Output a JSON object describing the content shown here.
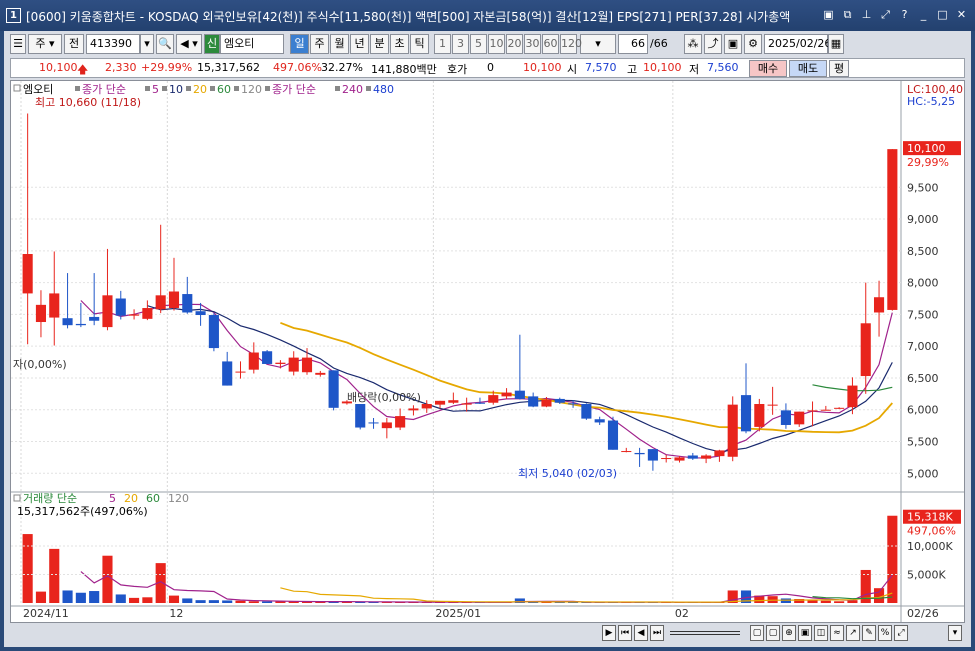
{
  "window": {
    "num": "1",
    "title": "[0600] 키움종합차트 - KOSDAQ 외국인보유[42(천)] 주식수[11,580(천)] 액면[500] 자본금[58(억)] 결산[12월] EPS[271] PER[37.28] 시가총액",
    "icons": [
      "restore-icon",
      "copy-icon",
      "pin-icon",
      "expand-icon",
      "help-icon",
      "minimize-icon",
      "maximize-icon",
      "close-icon"
    ]
  },
  "toolbar": {
    "market": "주",
    "prev": "전",
    "code": "413390",
    "badge": "신",
    "name": "엠오티",
    "periods": [
      "일",
      "주",
      "월",
      "년",
      "분",
      "초",
      "틱"
    ],
    "intervals": [
      "1",
      "3",
      "5",
      "10",
      "20",
      "30",
      "60",
      "120"
    ],
    "count": "66",
    "count_total": "/66",
    "date": "2025/02/26"
  },
  "quote": {
    "price": "10,100",
    "change": "2,330",
    "change_pct": "+29.99%",
    "volume": "15,317,562",
    "volume_pct": "497.06%",
    "turnover": "32.27%",
    "amount": "141,880백만",
    "hoga_label": "호가",
    "hoga": "0",
    "hoga_price": "10,100",
    "open_label": "시",
    "open": "7,570",
    "high_label": "고",
    "high": "10,100",
    "low_label": "저",
    "low": "7,560",
    "buy": "매수",
    "sell": "매도",
    "flat": "평"
  },
  "price_panel": {
    "stock": "엠오티",
    "legend": [
      {
        "text": "종가 단순",
        "color": "#a0228c"
      },
      {
        "text": "5",
        "color": "#a0228c"
      },
      {
        "text": "10",
        "color": "#1a2a6e"
      },
      {
        "text": "20",
        "color": "#e6a800"
      },
      {
        "text": "60",
        "color": "#2c8a3c"
      },
      {
        "text": "120",
        "color": "#888888"
      },
      {
        "text": "종가 단순",
        "color": "#a0228c"
      },
      {
        "text": "240",
        "color": "#a0228c"
      },
      {
        "text": "480",
        "color": "#1c3fd0"
      }
    ],
    "max_note": "최고 10,660 (11/18)",
    "min_note": "최저 5,040 (02/03)",
    "event_left": "자(0,00%)",
    "event_mid": "배당락(0,00%)",
    "lc": "LC:100,40",
    "hc": "HC:-5,25",
    "last_price": "10,100",
    "last_pct": "29,99%",
    "y_ticks": [
      "9,500",
      "9,000",
      "8,500",
      "8,000",
      "7,500",
      "7,000",
      "6,500",
      "6,000",
      "5,500",
      "5,000"
    ]
  },
  "volume_panel": {
    "label": "거래량 단순",
    "legend": [
      {
        "text": "5",
        "color": "#a0228c"
      },
      {
        "text": "20",
        "color": "#e6a800"
      },
      {
        "text": "60",
        "color": "#2c8a3c"
      },
      {
        "text": "120",
        "color": "#888888"
      }
    ],
    "max_note": "15,317,562주(497,06%)",
    "last_vol": "15,318K",
    "last_pct": "497,06%",
    "y_ticks": [
      "10,000K",
      "5,000K"
    ]
  },
  "x_axis": [
    "2024/11",
    "12",
    "2025/01",
    "02",
    "02/26"
  ],
  "chart_data": {
    "type": "candlestick",
    "series": [
      {
        "name": "엠오티",
        "candles": [
          [
            7830,
            10660,
            7030,
            8450
          ],
          [
            7380,
            7880,
            7140,
            7650
          ],
          [
            7450,
            8490,
            7010,
            7830
          ],
          [
            7440,
            8150,
            7280,
            7330
          ],
          [
            7350,
            7680,
            7300,
            7330
          ],
          [
            7460,
            8150,
            7330,
            7400
          ],
          [
            7300,
            8530,
            7250,
            7800
          ],
          [
            7750,
            7870,
            7420,
            7480
          ],
          [
            7480,
            7580,
            7420,
            7500
          ],
          [
            7430,
            7720,
            7410,
            7600
          ],
          [
            7580,
            8910,
            7520,
            7800
          ],
          [
            7600,
            8390,
            7560,
            7860
          ],
          [
            7820,
            8090,
            7510,
            7530
          ],
          [
            7550,
            7680,
            7320,
            7490
          ],
          [
            7490,
            7520,
            6920,
            6970
          ],
          [
            6760,
            6910,
            6380,
            6380
          ],
          [
            6600,
            6760,
            6490,
            6600
          ],
          [
            6630,
            7060,
            6570,
            6900
          ],
          [
            6920,
            6940,
            6720,
            6720
          ],
          [
            6720,
            6780,
            6650,
            6740
          ],
          [
            6600,
            6920,
            6540,
            6820
          ],
          [
            6590,
            6970,
            6550,
            6820
          ],
          [
            6550,
            6610,
            6520,
            6580
          ],
          [
            6620,
            6620,
            5990,
            6030
          ],
          [
            6100,
            6150,
            6080,
            6130
          ],
          [
            6090,
            6090,
            5690,
            5720
          ],
          [
            5800,
            5870,
            5700,
            5790
          ],
          [
            5710,
            5870,
            5550,
            5800
          ],
          [
            5720,
            6020,
            5680,
            5900
          ],
          [
            5990,
            6070,
            5910,
            6020
          ],
          [
            6020,
            6150,
            5950,
            6090
          ],
          [
            6080,
            6140,
            6020,
            6140
          ],
          [
            6110,
            6270,
            6090,
            6150
          ],
          [
            6080,
            6190,
            5970,
            6100
          ],
          [
            6110,
            6190,
            6090,
            6100
          ],
          [
            6110,
            6300,
            6080,
            6230
          ],
          [
            6210,
            6340,
            6170,
            6270
          ],
          [
            6300,
            7180,
            6160,
            6170
          ],
          [
            6210,
            6270,
            6040,
            6050
          ],
          [
            6050,
            6200,
            6040,
            6160
          ],
          [
            6170,
            6190,
            6090,
            6110
          ],
          [
            6100,
            6150,
            6030,
            6090
          ],
          [
            6090,
            6100,
            5840,
            5860
          ],
          [
            5850,
            5890,
            5760,
            5800
          ],
          [
            5830,
            5890,
            5370,
            5370
          ],
          [
            5350,
            5400,
            5330,
            5350
          ],
          [
            5320,
            5400,
            5100,
            5300
          ],
          [
            5380,
            5380,
            5040,
            5200
          ],
          [
            5230,
            5290,
            5170,
            5240
          ],
          [
            5200,
            5270,
            5170,
            5250
          ],
          [
            5280,
            5320,
            5210,
            5230
          ],
          [
            5230,
            5300,
            5160,
            5280
          ],
          [
            5270,
            5370,
            5180,
            5360
          ],
          [
            5260,
            6210,
            5190,
            6080
          ],
          [
            6230,
            6730,
            5630,
            5660
          ],
          [
            5730,
            6170,
            5660,
            6090
          ],
          [
            6080,
            6360,
            5920,
            6080
          ],
          [
            5990,
            6100,
            5700,
            5760
          ],
          [
            5770,
            5970,
            5730,
            5970
          ],
          [
            5980,
            6130,
            5740,
            5990
          ],
          [
            6000,
            6060,
            5990,
            6000
          ],
          [
            6030,
            6040,
            6010,
            6030
          ],
          [
            6040,
            6510,
            5930,
            6380
          ],
          [
            6530,
            8000,
            6250,
            7360
          ],
          [
            7530,
            8030,
            7150,
            7770
          ],
          [
            7570,
            10100,
            7560,
            10100
          ]
        ]
      },
      {
        "name": "거래량",
        "values": [
          12100,
          2000,
          9500,
          2200,
          1800,
          2100,
          8300,
          1500,
          900,
          1000,
          7000,
          1300,
          800,
          500,
          500,
          450,
          400,
          300,
          280,
          260,
          250,
          230,
          220,
          300,
          200,
          180,
          170,
          160,
          150,
          180,
          140,
          130,
          120,
          110,
          100,
          110,
          120,
          800,
          200,
          150,
          120,
          100,
          150,
          120,
          180,
          100,
          120,
          200,
          100,
          90,
          80,
          120,
          150,
          2200,
          2200,
          1300,
          1200,
          800,
          700,
          500,
          400,
          300,
          500,
          5800,
          2600,
          15318
        ]
      }
    ]
  }
}
